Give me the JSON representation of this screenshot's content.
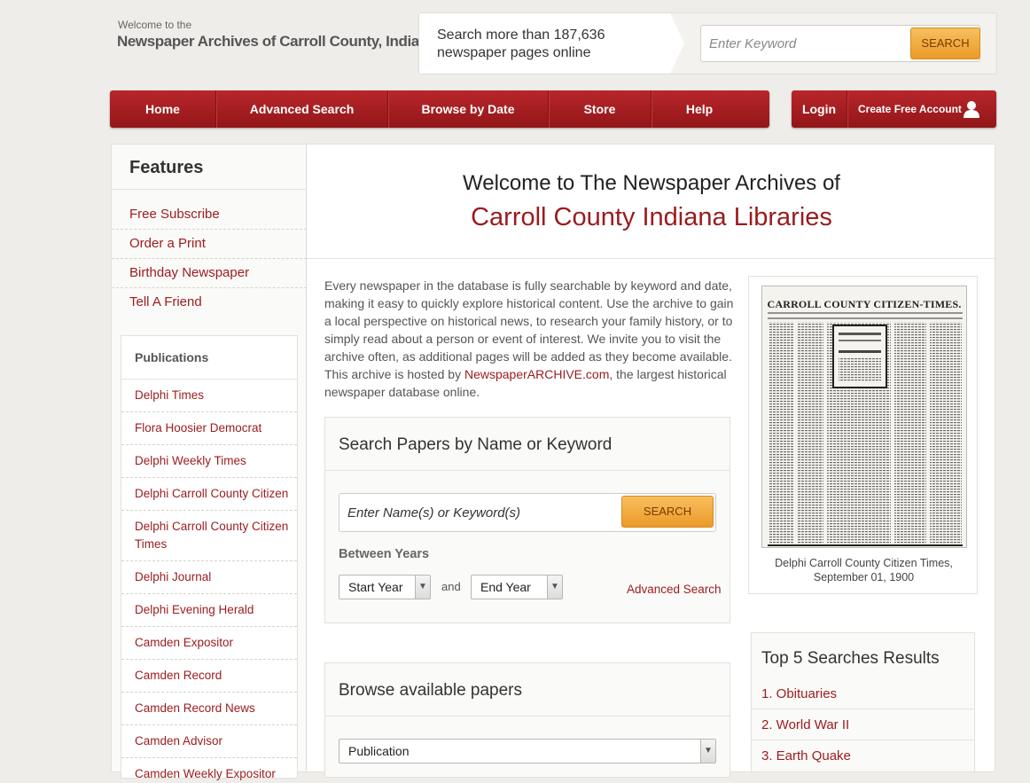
{
  "header": {
    "welcome": "Welcome to the",
    "site_name": "Newspaper Archives of Carroll County, Indiana",
    "callout_line1": "Search more than 187,636",
    "callout_line2": "newspaper pages online",
    "search_placeholder": "Enter Keyword",
    "search_button": "SEARCH"
  },
  "nav": {
    "items": [
      "Home",
      "Advanced Search",
      "Browse by Date",
      "Store",
      "Help"
    ],
    "login": "Login",
    "create_account": "Create Free Account"
  },
  "sidebar": {
    "features_title": "Features",
    "features": [
      "Free Subscribe",
      "Order a Print",
      "Birthday Newspaper",
      "Tell A Friend"
    ],
    "publications_title": "Publications",
    "publications": [
      "Delphi Times",
      "Flora Hoosier Democrat",
      "Delphi Weekly Times",
      "Delphi Carroll County Citizen",
      "Delphi Carroll County Citizen Times",
      "Delphi Journal",
      "Delphi Evening Herald",
      "Camden Expositor",
      "Camden Record",
      "Camden Record News",
      "Camden Advisor",
      "Camden Weekly Expositor"
    ]
  },
  "main": {
    "welcome_line1": "Welcome to The Newspaper Archives of",
    "welcome_line2": "Carroll County Indiana Libraries",
    "intro_before_link": "Every newspaper in the database is fully searchable by keyword and date, making it easy to quickly explore historical content. Use the archive to gain a local perspective on historical news, to research your family history, or to simply read about a person or event of interest. We invite you to visit the archive often, as additional pages will be added as they become available. This archive is hosted by ",
    "intro_link": "NewspaperARCHIVE.com",
    "intro_after_link": ", the largest historical newspaper database online.",
    "search_box_title": "Search Papers by Name or Keyword",
    "name_placeholder": "Enter Name(s) or Keyword(s)",
    "search_button": "SEARCH",
    "between_years": "Between Years",
    "start_year": "Start Year",
    "and": "and",
    "end_year": "End Year",
    "advanced_search": "Advanced Search",
    "browse_title": "Browse available papers",
    "browse_select": "Publication"
  },
  "thumbnail": {
    "masthead": "CARROLL COUNTY CITIZEN-TIMES.",
    "caption_line1": "Delphi Carroll County Citizen Times,",
    "caption_line2": "September 01, 1900"
  },
  "top_searches": {
    "title": "Top 5 Searches Results",
    "items": [
      "1. Obituaries",
      "2. World War II",
      "3. Earth Quake"
    ]
  }
}
